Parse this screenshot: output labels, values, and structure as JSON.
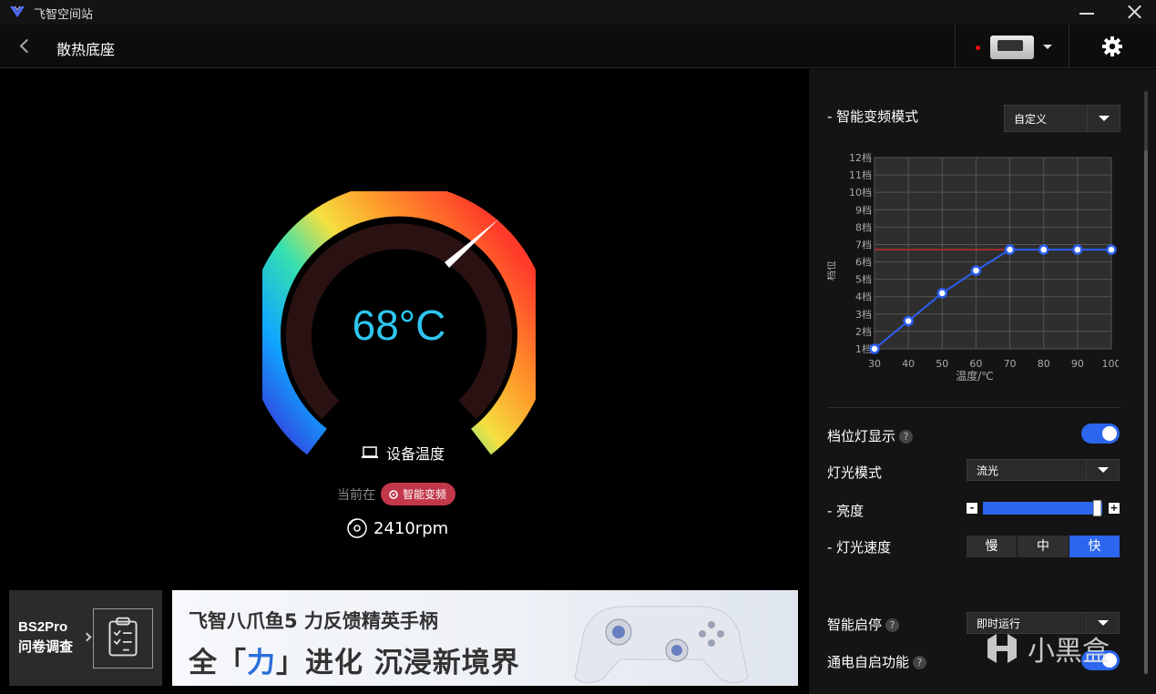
{
  "app": {
    "title": "飞智空间站"
  },
  "header": {
    "page_title": "散热底座"
  },
  "gauge": {
    "temperature": "68°C",
    "label": "设备温度",
    "mode_prefix": "当前在",
    "mode_badge": "智能变频",
    "rpm": "2410rpm"
  },
  "survey": {
    "line1": "BS2Pro",
    "line2": "问卷调查"
  },
  "ad": {
    "line1": "飞智八爪鱼5 力反馈精英手柄",
    "line2_pre": "全「",
    "line2_hl": "力",
    "line2_post": "」进化 沉浸新境界"
  },
  "panel": {
    "smart_mode_title": "- 智能变频模式",
    "smart_mode_value": "自定义",
    "indicator_light": "档位灯显示",
    "indicator_on": true,
    "light_mode_label": "灯光模式",
    "light_mode_value": "流光",
    "brightness_label": "- 亮度",
    "brightness_minus": "-",
    "brightness_plus": "+",
    "brightness_level": 0.92,
    "light_speed_label": "- 灯光速度",
    "speed_options": [
      "慢",
      "中",
      "快"
    ],
    "speed_selected": "快",
    "smart_start_label": "智能启停",
    "smart_start_value": "即时运行",
    "power_on_label": "通电自启功能",
    "help": "?"
  },
  "watermark": "小黑盒",
  "chart_data": {
    "type": "line",
    "title": "",
    "xlabel": "温度/℃",
    "ylabel": "档位",
    "x": [
      30,
      40,
      50,
      60,
      70,
      80,
      90,
      100
    ],
    "y_ticks": [
      "1档",
      "2档",
      "3档",
      "4档",
      "5档",
      "6档",
      "7档",
      "8档",
      "9档",
      "10档",
      "11档",
      "12档"
    ],
    "series": [
      {
        "values": [
          1,
          2.6,
          4.2,
          5.5,
          6.7,
          6.7,
          6.7,
          6.7
        ]
      }
    ],
    "reference_line": 6.7,
    "xlim": [
      30,
      100
    ],
    "ylim": [
      1,
      12
    ],
    "grid": true,
    "colors": {
      "line": "#2c5ff0",
      "reference": "#c0312b",
      "grid": "#555555"
    }
  }
}
